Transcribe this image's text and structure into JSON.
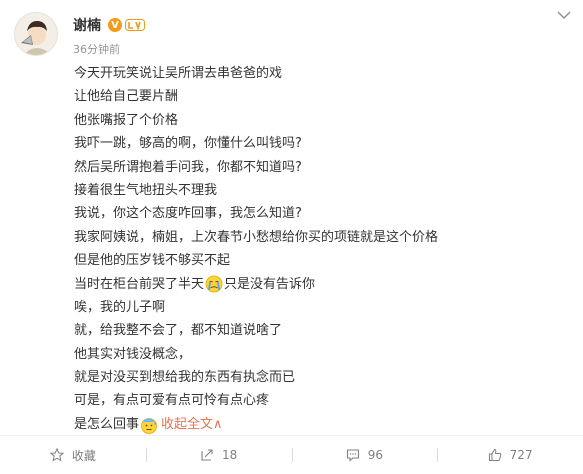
{
  "post": {
    "author": "谢楠",
    "verified_badge": "V",
    "timestamp": "36分钟前",
    "lines": [
      "今天开玩笑说让吴所谓去串爸爸的戏",
      "让他给自己要片酬",
      "他张嘴报了个价格",
      "我吓一跳，够高的啊，你懂什么叫钱吗?",
      "然后吴所谓抱着手问我，你都不知道吗?",
      "接着很生气地扭头不理我",
      "我说，你这个态度咋回事，我怎么知道?",
      "我家阿姨说，楠姐，上次春节小愁想给你买的项链就是这个价格",
      "但是他的压岁钱不够买不起"
    ],
    "line_with_emoji": {
      "before": "当时在柜台前哭了半天",
      "emoji": "crying-face-icon",
      "after": "只是没有告诉你"
    },
    "lines_after": [
      "唉，我的儿子啊",
      "就，给我整不会了，都不知道说啥了",
      "他其实对钱没概念，",
      "就是对没买到想给我的东西有执念而已",
      "可是，有点可爱有点可怜有点心疼"
    ],
    "last_line": {
      "text": "是怎么回事",
      "emoji": "sweat-face-icon",
      "collapse_label": "收起全文",
      "collapse_arrow": "∧"
    }
  },
  "actions": {
    "favorite": {
      "label": "收藏",
      "icon": "star-icon"
    },
    "repost": {
      "count": "18",
      "icon": "repost-icon"
    },
    "comment": {
      "count": "96",
      "icon": "comment-icon"
    },
    "like": {
      "count": "727",
      "icon": "thumbs-up-icon"
    }
  },
  "colors": {
    "text": "#333333",
    "muted": "#939393",
    "link": "#eb7350",
    "badge": "#f49b19"
  }
}
